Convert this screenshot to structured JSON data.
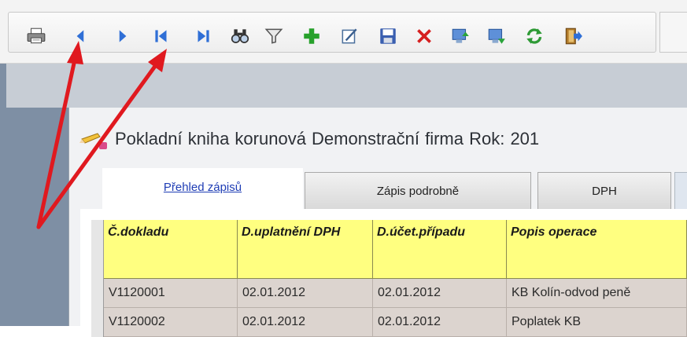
{
  "colors": {
    "mdi_background": "#7e8fa4",
    "header_fill": "#ffff80",
    "row_fill": "#dcd4cf",
    "active_tab_text": "#1f3db5",
    "annotation_arrow": "#e0191f"
  },
  "toolbar": {
    "buttons": [
      {
        "name": "print-icon"
      },
      {
        "name": "previous-record-icon"
      },
      {
        "name": "next-record-icon"
      },
      {
        "name": "first-record-icon"
      },
      {
        "name": "last-record-icon"
      },
      {
        "name": "find-icon"
      },
      {
        "name": "filter-icon"
      },
      {
        "name": "add-record-icon"
      },
      {
        "name": "edit-record-icon"
      },
      {
        "name": "save-icon"
      },
      {
        "name": "delete-icon"
      },
      {
        "name": "export-icon"
      },
      {
        "name": "import-icon"
      },
      {
        "name": "refresh-icon"
      },
      {
        "name": "exit-icon"
      }
    ]
  },
  "window": {
    "title": "Pokladní kniha korunová  Demonstrační firma  Rok: 201"
  },
  "tabs": [
    {
      "label": "Přehled zápisů",
      "active": true
    },
    {
      "label": "Zápis podrobně",
      "active": false
    },
    {
      "label": "DPH",
      "active": false
    }
  ],
  "grid": {
    "columns": [
      "Č.dokladu",
      "D.uplatnění DPH",
      "D.účet.případu",
      "Popis operace"
    ],
    "rows": [
      [
        "V1120001",
        "02.01.2012",
        "02.01.2012",
        "KB Kolín-odvod peně"
      ],
      [
        "V1120002",
        "02.01.2012",
        "02.01.2012",
        "Poplatek KB"
      ]
    ]
  }
}
